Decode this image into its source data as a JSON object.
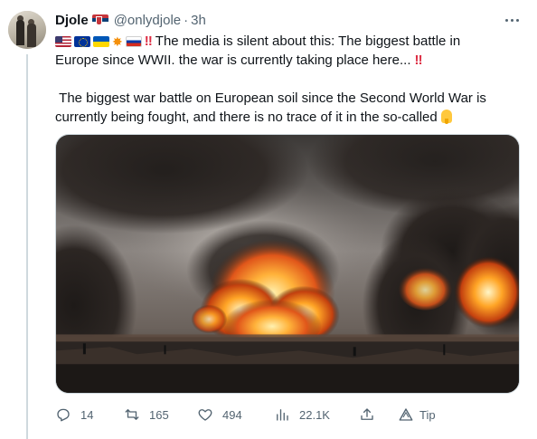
{
  "tweet": {
    "author": {
      "display_name": "Djole",
      "handle": "@onlydjole",
      "separator": "·",
      "time": "3h"
    },
    "text": {
      "line1_tail": "The media is silent about this: The biggest battle in",
      "line2": "Europe since WWII.  the war is currently taking place here...",
      "paragraph2": "The biggest war battle on European soil since the Second World War is currently being fought, and there is no trace of it in the so-called",
      "bangbang": "‼"
    },
    "emojis": [
      "flag-us",
      "flag-eu",
      "flag-ua",
      "collision",
      "flag-ru",
      "double-exclamation",
      "backhand-index-pointing-down"
    ],
    "media": {
      "alt_description": ""
    },
    "actions": {
      "reply_count": "14",
      "retweet_count": "165",
      "like_count": "494",
      "views_count": "22.1K",
      "tip_label": "Tip"
    },
    "icons": {
      "more": "more-icon",
      "reply": "reply-icon",
      "retweet": "retweet-icon",
      "like": "heart-icon",
      "views": "views-icon",
      "share": "share-icon",
      "tip": "tip-icon"
    },
    "colors": {
      "text": "#0f1419",
      "secondary": "#536471",
      "thread_line": "#cfd9de",
      "alert_red": "#dd2e44"
    }
  }
}
